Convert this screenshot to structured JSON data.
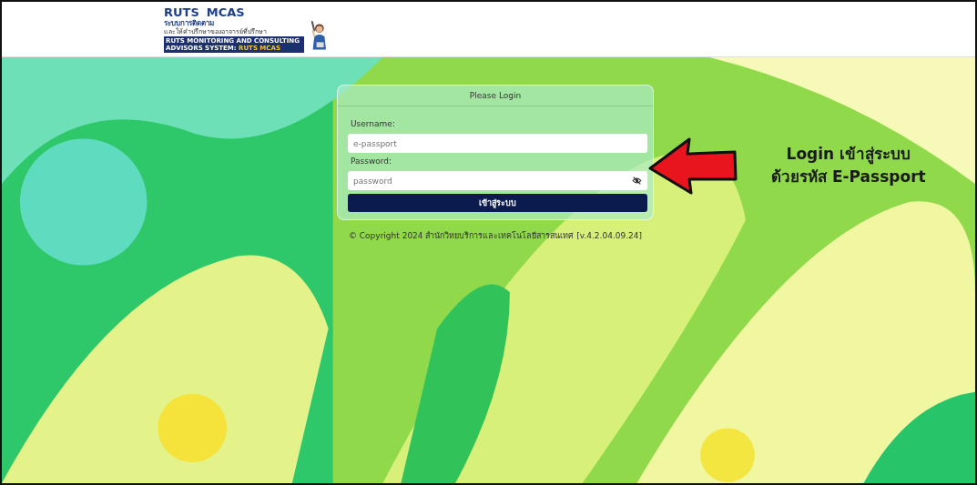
{
  "header": {
    "logo": {
      "title_left": "RUTS",
      "title_right": "MCAS",
      "subtitle": "ระบบการติดตาม",
      "tagline": "และให้คำปรึกษาของอาจารย์ที่ปรึกษา",
      "banner": "RUTS MONITORING AND CONSULTING ADVISORS SYSTEM:",
      "banner_highlight": "RUTS MCAS"
    }
  },
  "login": {
    "title": "Please Login",
    "fields": [
      {
        "label": "Username:",
        "placeholder": "e-passport",
        "kind": "text"
      },
      {
        "label": "Password:",
        "placeholder": "password",
        "kind": "password"
      }
    ],
    "button": "เข้าสู่ระบบ"
  },
  "footer": "© Copyright 2024 สำนักวิทยบริการและเทคโนโลยีสารสนเทศ [v.4.2.04.09.24]",
  "annotation": {
    "lines": [
      "Login เข้าสู่ระบบ",
      "ด้วยรหัส E-Passport"
    ]
  }
}
